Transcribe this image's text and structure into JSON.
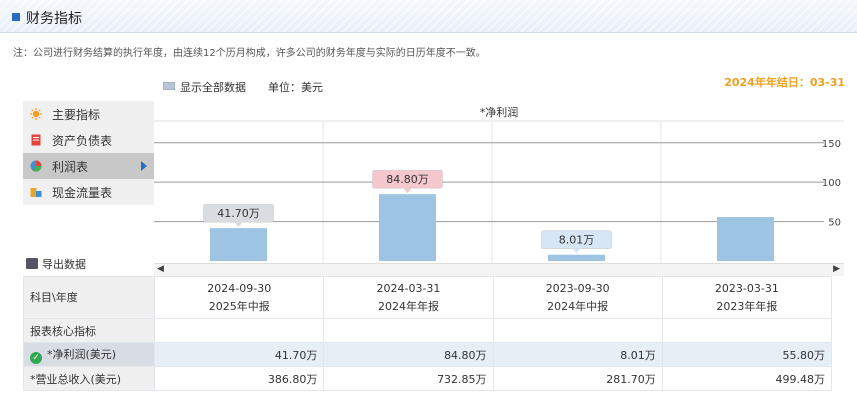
{
  "header": {
    "title": "财务指标"
  },
  "note": "注：公司进行财务结算的执行年度，由连续12个历月构成，许多公司的财务年度与实际的日历年度不一致。",
  "toolbar": {
    "show_all_label": "显示全部数据",
    "unit_label": "单位：美元",
    "fy_end_label": "2024年年结日：03-31"
  },
  "sidebar": {
    "items": [
      {
        "label": "主要指标",
        "icon": "sun-icon"
      },
      {
        "label": "资产负债表",
        "icon": "document-icon"
      },
      {
        "label": "利润表",
        "icon": "pie-chart-icon"
      },
      {
        "label": "现金流量表",
        "icon": "coins-icon"
      }
    ],
    "active_index": 2
  },
  "export_label": "导出数据",
  "chart_data": {
    "type": "bar",
    "title": "*净利润",
    "categories": [
      "2024-09-30",
      "2024-03-31",
      "2023-09-30",
      "2023-03-31"
    ],
    "values": [
      41.7,
      84.8,
      8.01,
      55.8
    ],
    "data_labels": [
      "41.70万",
      "84.80万",
      "8.01万",
      ""
    ],
    "yticks": [
      50,
      100,
      150
    ],
    "ylim": [
      0,
      170
    ],
    "ylabel": "",
    "xlabel": "",
    "grid": true,
    "colors": {
      "bar": "#9ec4e4",
      "label_pink": "#f4c8cc",
      "label_gray": "#d9dde2",
      "label_blue": "#d6e6f4"
    }
  },
  "table": {
    "corner_label": "科目\\年度",
    "columns": [
      {
        "date": "2024-09-30",
        "report": "2025年中报"
      },
      {
        "date": "2024-03-31",
        "report": "2024年年报"
      },
      {
        "date": "2023-09-30",
        "report": "2024年中报"
      },
      {
        "date": "2023-03-31",
        "report": "2023年年报"
      }
    ],
    "section_label": "报表核心指标",
    "rows": [
      {
        "label": "*净利润(美元)",
        "values": [
          "41.70万",
          "84.80万",
          "8.01万",
          "55.80万"
        ],
        "checked": true
      },
      {
        "label": "*营业总收入(美元)",
        "values": [
          "386.80万",
          "732.85万",
          "281.70万",
          "499.48万"
        ],
        "checked": false
      }
    ]
  }
}
